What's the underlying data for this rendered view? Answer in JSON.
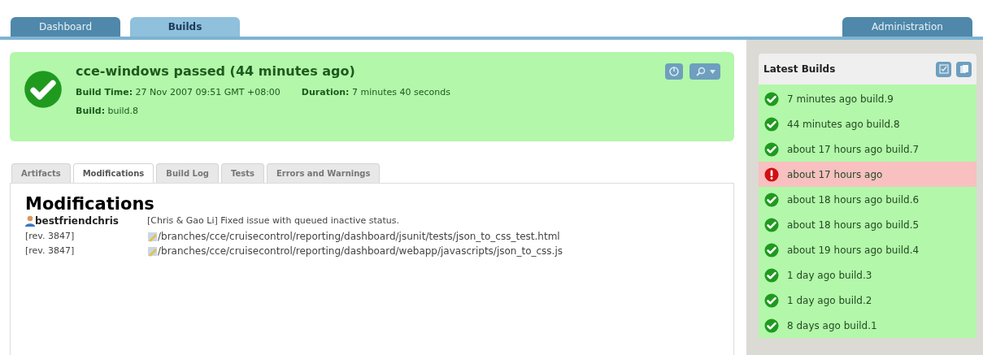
{
  "nav_tabs": [
    {
      "label": "Dashboard",
      "selected": false
    },
    {
      "label": "Builds",
      "selected": true
    }
  ],
  "admin_tab": {
    "label": "Administration",
    "selected": false
  },
  "build_summary": {
    "success": true,
    "title": "cce-windows passed (44 minutes ago)",
    "build_time_label": "Build Time:",
    "build_time": "27 Nov 2007 09:51 GMT +08:00",
    "duration_label": "Duration:",
    "duration": "7 minutes 40 seconds",
    "build_label": "Build:",
    "build": "build.8"
  },
  "detail_tabs": [
    {
      "label": "Artifacts",
      "selected": false
    },
    {
      "label": "Modifications",
      "selected": true
    },
    {
      "label": "Build Log",
      "selected": false
    },
    {
      "label": "Tests",
      "selected": false
    },
    {
      "label": "Errors and Warnings",
      "selected": false
    }
  ],
  "modifications": {
    "heading": "Modifications",
    "user": "bestfriendchris",
    "comment": "[Chris & Gao Li] Fixed issue with queued inactive status.",
    "files": [
      {
        "revision": "[rev. 3847]",
        "path": "/branches/cce/cruisecontrol/reporting/dashboard/jsunit/tests/json_to_css_test.html"
      },
      {
        "revision": "[rev. 3847]",
        "path": "/branches/cce/cruisecontrol/reporting/dashboard/webapp/javascripts/json_to_css.js"
      }
    ]
  },
  "latest_builds": {
    "title": "Latest Builds",
    "items": [
      {
        "label": "7 minutes ago build.9",
        "kind": "passed"
      },
      {
        "label": "44 minutes ago build.8",
        "kind": "passed"
      },
      {
        "label": "about 17 hours ago build.7",
        "kind": "passed"
      },
      {
        "label": "about 17 hours ago",
        "kind": "failed"
      },
      {
        "label": "about 18 hours ago build.6",
        "kind": "passed"
      },
      {
        "label": "about 18 hours ago build.5",
        "kind": "passed"
      },
      {
        "label": "about 19 hours ago build.4",
        "kind": "passed"
      },
      {
        "label": "1 day ago build.3",
        "kind": "passed"
      },
      {
        "label": "1 day ago build.2",
        "kind": "passed"
      },
      {
        "label": "8 days ago build.1",
        "kind": "passed"
      }
    ]
  }
}
